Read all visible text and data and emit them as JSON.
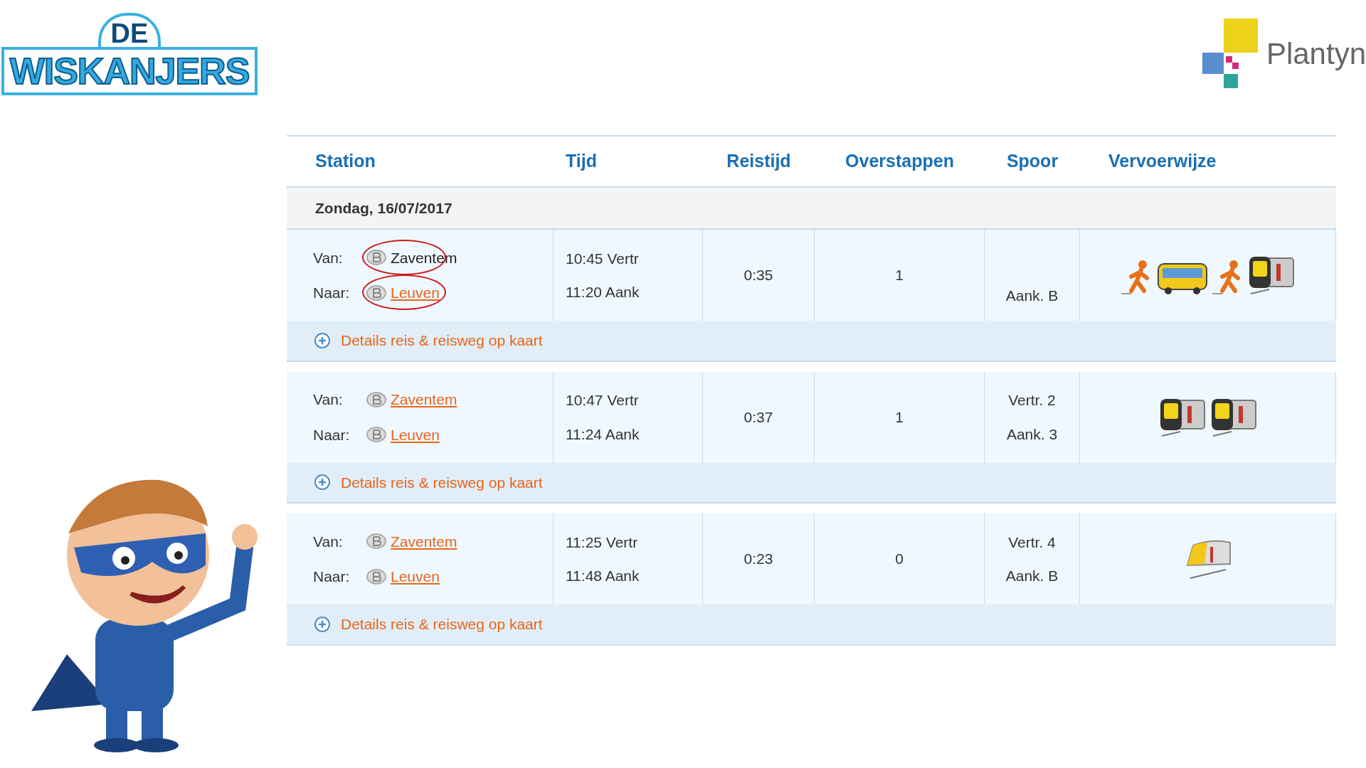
{
  "logo_left": {
    "top": "DE",
    "main": "WISKANJERS"
  },
  "logo_right": {
    "name": "Plantyn"
  },
  "table": {
    "columns": [
      "Station",
      "Tijd",
      "Reistijd",
      "Overstappen",
      "Spoor",
      "Vervoerwijze"
    ],
    "date": "Zondag, 16/07/2017",
    "rows": [
      {
        "from_label": "Van:",
        "from": {
          "name": "Zaventem",
          "link": false,
          "circled": true
        },
        "to_label": "Naar:",
        "to": {
          "name": "Leuven",
          "link": true,
          "circled": true
        },
        "times": [
          "10:45 Vertr",
          "11:20 Aank"
        ],
        "duration": "0:35",
        "transfers": "1",
        "platforms": [
          "Aank. B"
        ],
        "modes": [
          {
            "kind": "walk"
          },
          {
            "kind": "bus"
          },
          {
            "kind": "walk"
          },
          {
            "kind": "metro"
          }
        ],
        "details": "Details reis & reisweg op kaart"
      },
      {
        "from_label": "Van:",
        "from": {
          "name": "Zaventem",
          "link": true,
          "circled": false
        },
        "to_label": "Naar:",
        "to": {
          "name": "Leuven",
          "link": true,
          "circled": false
        },
        "times": [
          "10:47 Vertr",
          "11:24 Aank"
        ],
        "duration": "0:37",
        "transfers": "1",
        "platforms": [
          "Vertr. 2",
          "Aank. 3"
        ],
        "modes": [
          {
            "kind": "metro"
          },
          {
            "kind": "metro"
          }
        ],
        "details": "Details reis & reisweg op kaart"
      },
      {
        "from_label": "Van:",
        "from": {
          "name": "Zaventem",
          "link": true,
          "circled": false
        },
        "to_label": "Naar:",
        "to": {
          "name": "Leuven",
          "link": true,
          "circled": false
        },
        "times": [
          "11:25 Vertr",
          "11:48 Aank"
        ],
        "duration": "0:23",
        "transfers": "0",
        "platforms": [
          "Vertr. 4",
          "Aank. B"
        ],
        "modes": [
          {
            "kind": "train"
          }
        ],
        "details": "Details reis & reisweg op kaart"
      }
    ]
  }
}
